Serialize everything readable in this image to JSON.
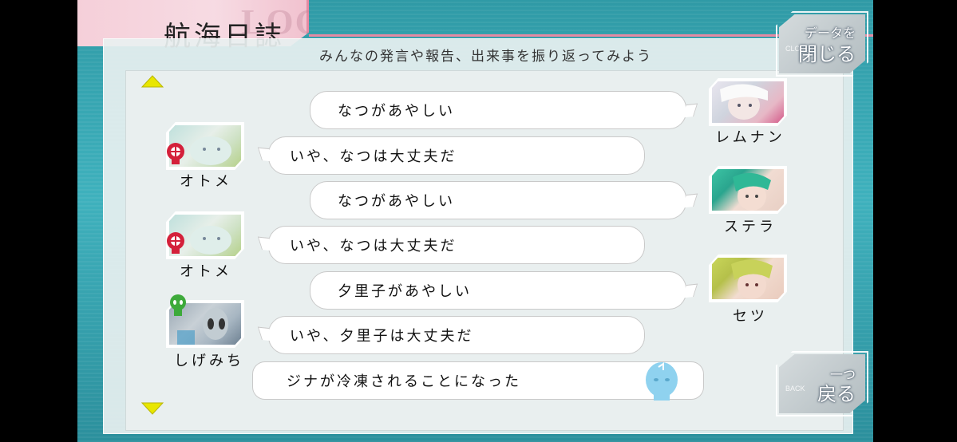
{
  "header": {
    "title": "航海日誌",
    "subtitle": "みんなの発言や報告、出来事を振り返ってみよう"
  },
  "buttons": {
    "close_data_line1": "データを",
    "close_data_line2": "閉じる",
    "back_line1": "一つ",
    "back_line2": "戻る"
  },
  "log": [
    {
      "speaker": "レムナン",
      "side": "right",
      "text": "なつがあやしい"
    },
    {
      "speaker": "オトメ",
      "side": "left",
      "text": "いや、なつは大丈夫だ"
    },
    {
      "speaker": "ステラ",
      "side": "right",
      "text": "なつがあやしい"
    },
    {
      "speaker": "オトメ",
      "side": "left",
      "text": "いや、なつは大丈夫だ"
    },
    {
      "speaker": "セツ",
      "side": "right",
      "text": "夕里子があやしい"
    },
    {
      "speaker": "しげみち",
      "side": "left",
      "text": "いや、夕里子は大丈夫だ"
    },
    {
      "speaker": "",
      "side": "event",
      "text": "ジナが冷凍されることになった"
    }
  ],
  "colors": {
    "accent_pink": "#e58aa3",
    "teal": "#3fb1bd",
    "arrow_yellow": "#e8e600",
    "badge_red": "#d4203a",
    "badge_green": "#3daa3a"
  },
  "icons": {
    "scroll_up": "triangle-up-icon",
    "scroll_down": "triangle-down-icon",
    "enemy_badge": "red-skull-badge-icon",
    "ally_badge": "green-alien-badge-icon",
    "event_icon": "frozen-head-icon"
  }
}
